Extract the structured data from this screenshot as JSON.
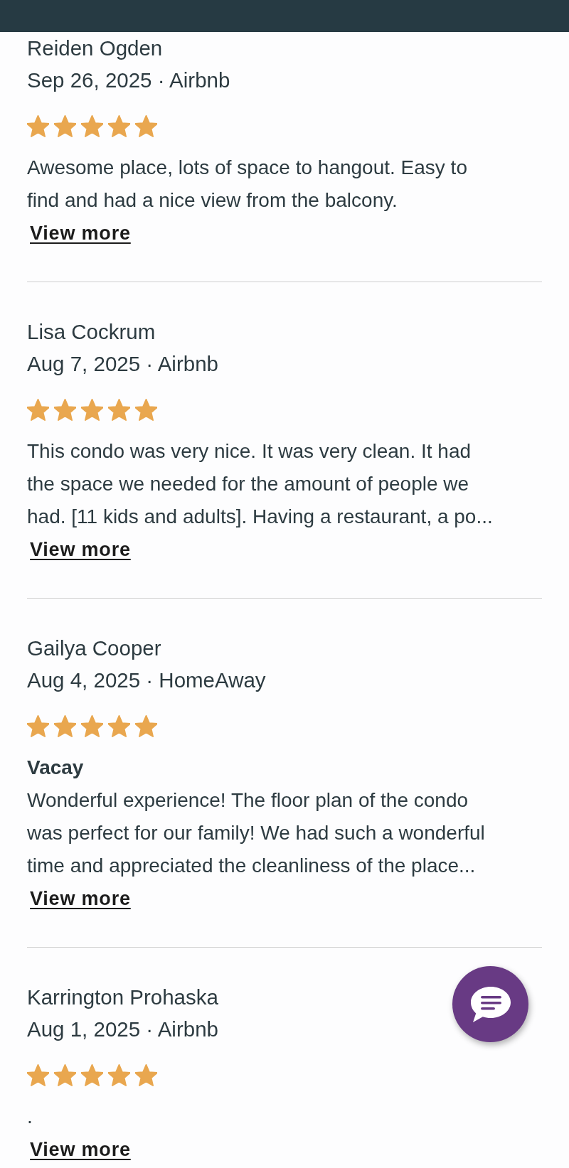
{
  "reviews": [
    {
      "author": "Reiden Ogden",
      "meta": "Sep 26, 2025 · Airbnb",
      "stars": 5,
      "body": [
        "Awesome place, lots of space to hangout. Easy to",
        "find and had a nice view from the balcony."
      ],
      "link": "View more"
    },
    {
      "author": "Lisa Cockrum",
      "meta": "Aug 7, 2025 · Airbnb",
      "stars": 5,
      "body": [
        "This condo was very nice. It was very clean. It had",
        "the space we needed for the amount of people we",
        "had. [11 kids and adults]. Having a restaurant, a po..."
      ],
      "link": "View more"
    },
    {
      "author": "Gailya Cooper",
      "meta": "Aug 4, 2025 · HomeAway",
      "stars": 5,
      "title": "Vacay",
      "body": [
        "Wonderful experience! The floor plan of the condo",
        "was perfect for our family! We had such a wonderful",
        "time and appreciated the cleanliness of the place..."
      ],
      "link": "View more"
    },
    {
      "author": "Karrington Prohaska",
      "meta": "Aug 1, 2025 · Airbnb",
      "stars": 5,
      "body": [
        "."
      ],
      "link": "View more"
    }
  ]
}
